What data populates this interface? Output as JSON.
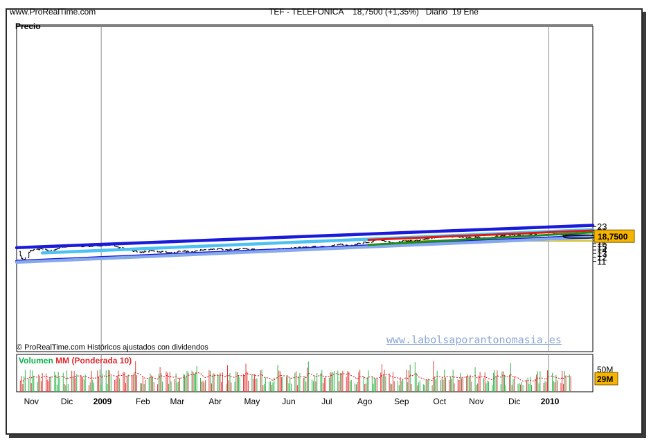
{
  "header": {
    "site": "www.ProRealTime.com",
    "instrument_line": "TEF - TELEFONICA    18,7500 (+1,35%)   Diario  19 Ene"
  },
  "price_panel": {
    "caption": "Precio"
  },
  "footer_note": "© ProRealTime.com  Históricos ajustados con dividendos",
  "watermark": "www.labolsaporantonomasia.es",
  "volume_panel": {
    "label_a": "Volumen",
    "label_b": "MM (Ponderada 10)"
  },
  "colors": {
    "channel_blue": "#1a1adb",
    "channel_light": "#86a9ea",
    "cyan_line": "#4ec1f2",
    "red_line": "#e01818",
    "green_line": "#1e8e1e",
    "support_band": "#f7e97a",
    "price_tag": "#f5b400",
    "volume_up": "#2fb54a",
    "volume_down": "#e33a3a"
  },
  "chart_data": [
    {
      "type": "line",
      "title": "",
      "series_description": "daily price bars",
      "y_scale": "log",
      "ylim": [
        10.8,
        24.5
      ],
      "y_ticks": [
        "11",
        "12",
        "13",
        "14",
        "15",
        "16",
        "17",
        "18",
        "19",
        "21",
        "23"
      ],
      "x_ticks": [
        "Nov",
        "Dic",
        "2009",
        "Feb",
        "Mar",
        "Abr",
        "May",
        "Jun",
        "Jul",
        "Ago",
        "Sep",
        "Oct",
        "Nov",
        "Dic",
        "2010"
      ],
      "last_price": "18,7500",
      "price_points": [
        [
          "2008-10-25",
          13.6
        ],
        [
          "2008-10-29",
          11.1
        ],
        [
          "2008-11-04",
          13.8
        ],
        [
          "2008-11-12",
          14.3
        ],
        [
          "2008-11-20",
          13.6
        ],
        [
          "2008-11-28",
          14.8
        ],
        [
          "2008-12-08",
          15.3
        ],
        [
          "2008-12-18",
          15.0
        ],
        [
          "2008-12-30",
          15.4
        ],
        [
          "2009-01-08",
          15.6
        ],
        [
          "2009-01-16",
          14.6
        ],
        [
          "2009-01-24",
          13.9
        ],
        [
          "2009-02-02",
          13.3
        ],
        [
          "2009-02-10",
          13.9
        ],
        [
          "2009-02-20",
          13.4
        ],
        [
          "2009-02-28",
          13.1
        ],
        [
          "2009-03-08",
          13.7
        ],
        [
          "2009-03-18",
          13.5
        ],
        [
          "2009-03-26",
          14.2
        ],
        [
          "2009-04-06",
          14.3
        ],
        [
          "2009-04-16",
          14.1
        ],
        [
          "2009-04-26",
          14.4
        ],
        [
          "2009-05-04",
          14.2
        ],
        [
          "2009-05-12",
          13.6
        ],
        [
          "2009-05-20",
          14.2
        ],
        [
          "2009-05-28",
          14.3
        ],
        [
          "2009-06-08",
          14.6
        ],
        [
          "2009-06-18",
          14.9
        ],
        [
          "2009-06-28",
          15.0
        ],
        [
          "2009-07-06",
          14.9
        ],
        [
          "2009-07-14",
          15.9
        ],
        [
          "2009-07-22",
          15.1
        ],
        [
          "2009-07-30",
          16.1
        ],
        [
          "2009-08-07",
          16.6
        ],
        [
          "2009-08-14",
          17.3
        ],
        [
          "2009-08-20",
          16.9
        ],
        [
          "2009-08-28",
          16.0
        ],
        [
          "2009-09-04",
          17.0
        ],
        [
          "2009-09-12",
          16.9
        ],
        [
          "2009-09-20",
          17.4
        ],
        [
          "2009-09-28",
          18.1
        ],
        [
          "2009-10-08",
          18.6
        ],
        [
          "2009-10-18",
          18.5
        ],
        [
          "2009-10-26",
          18.1
        ],
        [
          "2009-11-04",
          18.3
        ],
        [
          "2009-11-12",
          18.1
        ],
        [
          "2009-11-22",
          18.9
        ],
        [
          "2009-12-01",
          19.3
        ],
        [
          "2009-12-10",
          18.9
        ],
        [
          "2009-12-18",
          19.4
        ],
        [
          "2009-12-28",
          19.0
        ],
        [
          "2010-01-05",
          19.5
        ],
        [
          "2010-01-12",
          19.3
        ],
        [
          "2010-01-15",
          18.6
        ],
        [
          "2010-01-19",
          18.75
        ]
      ],
      "trend_lines": [
        {
          "color": "#1a1adb",
          "from": [
            "2008-10-24",
            14.7
          ],
          "to": [
            "2010-02-06",
            23.6
          ]
        },
        {
          "color": "#1a1adb",
          "from": [
            "2008-10-24",
            11.0
          ],
          "to": [
            "2010-02-06",
            18.75
          ]
        },
        {
          "color": "#86a9ea",
          "from": [
            "2008-10-24",
            10.8
          ],
          "to": [
            "2010-02-06",
            18.35
          ]
        },
        {
          "color": "#4ec1f2",
          "from": [
            "2008-11-14",
            13.15
          ],
          "to": [
            "2010-02-06",
            21.5
          ]
        },
        {
          "color": "#e01818",
          "from": [
            "2009-08-07",
            17.35
          ],
          "to": [
            "2010-02-06",
            21.15
          ]
        },
        {
          "color": "#1e8e1e",
          "from": [
            "2009-08-07",
            15.6
          ],
          "to": [
            "2010-02-06",
            20.3
          ]
        }
      ],
      "support_band": {
        "y": [
          16.85,
          17.2
        ],
        "from": "2009-09-05",
        "to": "2010-02-06"
      }
    },
    {
      "type": "bar",
      "title": "",
      "series_description": "daily volume with weighted moving average (10)",
      "y_ticks": [
        "50M"
      ],
      "last_value": "29M",
      "ylim": [
        0,
        70
      ]
    }
  ]
}
